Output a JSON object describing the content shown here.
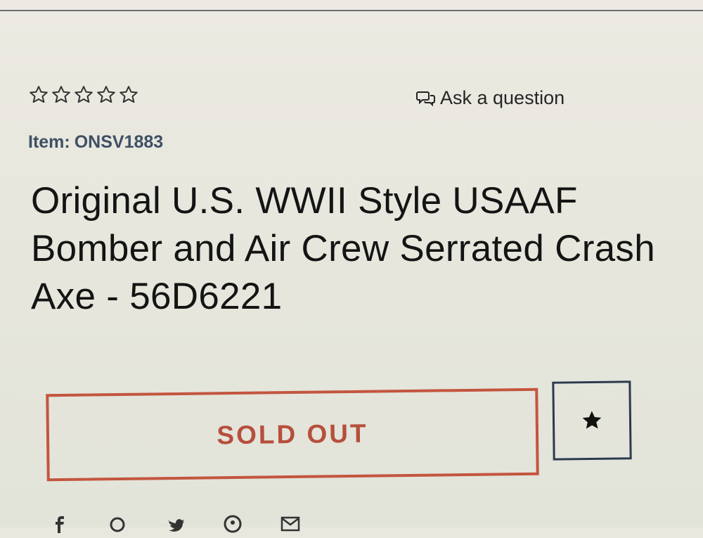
{
  "rating": {
    "stars_total": 5,
    "stars_filled": 0
  },
  "ask_question": {
    "label": "Ask a question"
  },
  "item": {
    "prefix": "Item:",
    "code": "ONSV1883"
  },
  "product": {
    "title_line1": "Original U.S. WWII Style USAAF",
    "title_line2": "Bomber and Air Crew Serrated Crash",
    "title_line3": "Axe - 56D6221"
  },
  "actions": {
    "sold_out_label": "SOLD OUT"
  },
  "colors": {
    "sold_out_red": "#c4553f",
    "item_label": "#3e5063",
    "wishlist_border": "#2d3a4d"
  },
  "icons": {
    "ask": "speech-bubbles-icon",
    "wishlist": "star-icon",
    "share": [
      "facebook-icon",
      "google-icon",
      "twitter-icon",
      "pinterest-icon",
      "email-icon"
    ]
  }
}
